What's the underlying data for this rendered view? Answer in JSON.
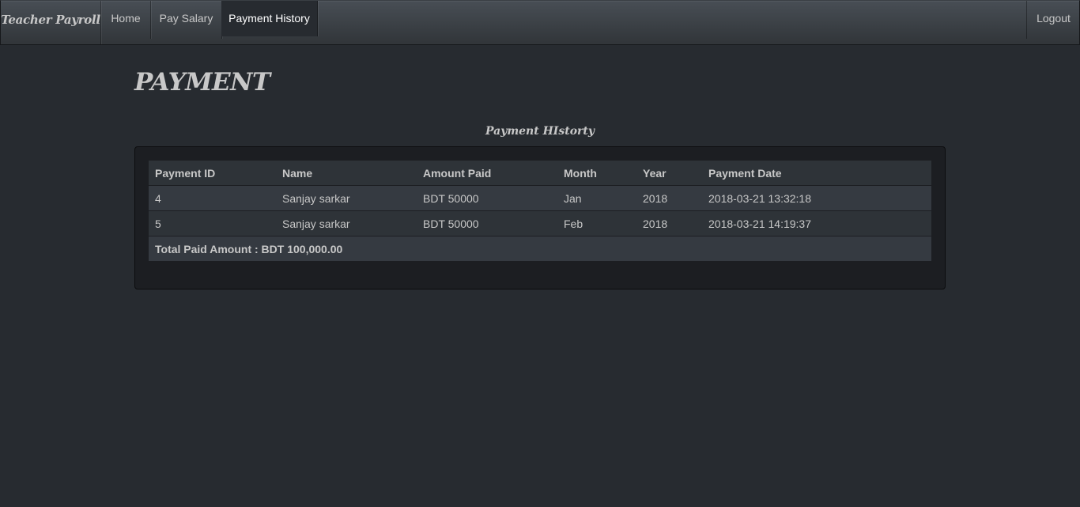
{
  "nav": {
    "brand": "Teacher Payroll",
    "items": [
      {
        "label": "Home"
      },
      {
        "label": "Pay Salary"
      },
      {
        "label": "Payment History"
      }
    ],
    "logout": "Logout"
  },
  "page": {
    "title": "PAYMENT",
    "section_title": "Payment HIstorty"
  },
  "table": {
    "headers": [
      "Payment ID",
      "Name",
      "Amount Paid",
      "Month",
      "Year",
      "Payment Date"
    ],
    "rows": [
      [
        "4",
        "Sanjay sarkar",
        "BDT 50000",
        "Jan",
        "2018",
        "2018-03-21 13:32:18"
      ],
      [
        "5",
        "Sanjay sarkar",
        "BDT 50000",
        "Feb",
        "2018",
        "2018-03-21 14:19:37"
      ]
    ],
    "total": "Total Paid Amount : BDT 100,000.00"
  }
}
